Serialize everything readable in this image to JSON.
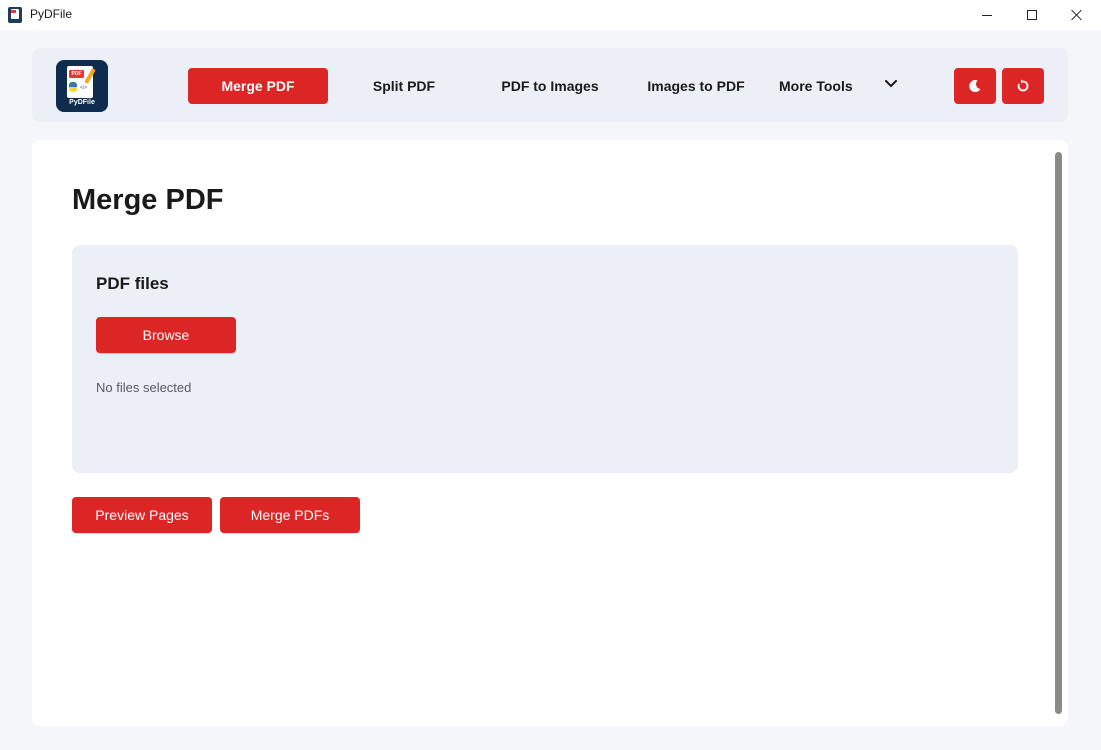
{
  "window": {
    "title": "PyDFile"
  },
  "logo": {
    "text": "PyDFile",
    "tag": "PDF"
  },
  "nav": {
    "tabs": [
      {
        "label": "Merge PDF",
        "active": true
      },
      {
        "label": "Split PDF",
        "active": false
      },
      {
        "label": "PDF to Images",
        "active": false
      },
      {
        "label": "Images to PDF",
        "active": false
      },
      {
        "label": "More Tools",
        "active": false
      }
    ],
    "more_icon": "chevron-down-icon",
    "theme_icon": "moon-icon",
    "refresh_icon": "refresh-icon"
  },
  "main": {
    "title": "Merge PDF",
    "panel": {
      "title": "PDF files",
      "browse_label": "Browse",
      "status": "No files selected"
    },
    "actions": {
      "preview_label": "Preview Pages",
      "merge_label": "Merge PDFs"
    }
  },
  "colors": {
    "accent": "#dc2626",
    "panel_bg": "#eceff5",
    "page_bg": "#f4f6fa"
  }
}
